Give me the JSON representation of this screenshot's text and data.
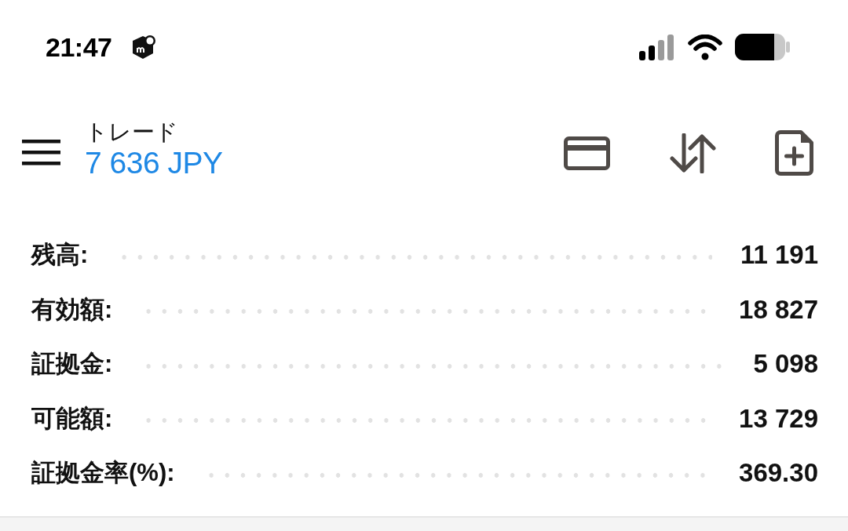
{
  "status_bar": {
    "time": "21:47"
  },
  "header": {
    "title": "トレード",
    "balance": "7 636 JPY"
  },
  "account_rows": [
    {
      "label": "残高:",
      "value": "11 191"
    },
    {
      "label": "有効額:",
      "value": "18 827"
    },
    {
      "label": "証拠金:",
      "value": "5 098"
    },
    {
      "label": "可能額:",
      "value": "13 729"
    },
    {
      "label": "証拠金率(%):",
      "value": "369.30"
    }
  ]
}
